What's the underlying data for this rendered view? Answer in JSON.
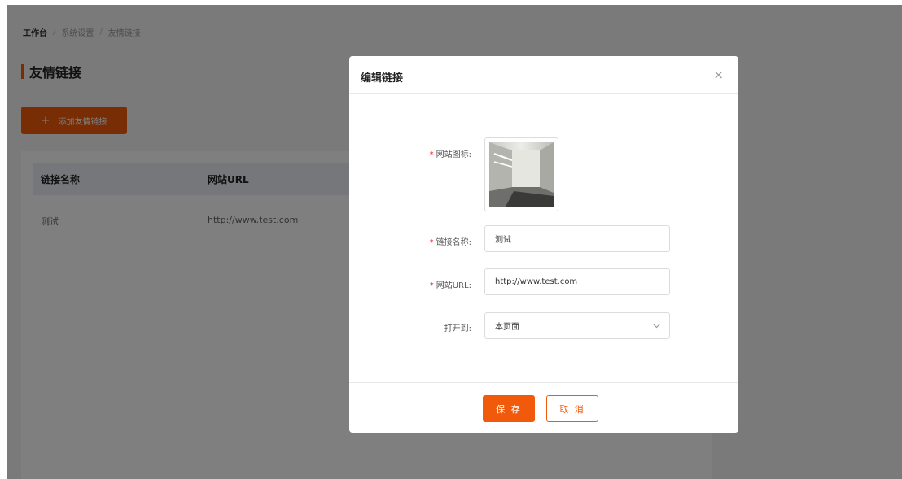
{
  "breadcrumb": [
    "工作台",
    "系统设置",
    "友情链接"
  ],
  "breadcrumb_separator": "/",
  "page_title": "友情链接",
  "add_button": {
    "icon": "+",
    "label": "添加友情链接"
  },
  "table": {
    "headers": [
      "链接名称",
      "网站URL"
    ],
    "rows": [
      {
        "name": "测试",
        "url": "http://www.test.com"
      }
    ]
  },
  "modal": {
    "title": "编辑链接",
    "close_icon": "×",
    "form": {
      "icon_label": "网站图标:",
      "name_label": "链接名称:",
      "name_value": "测试",
      "url_label": "网站URL:",
      "url_value": "http://www.test.com",
      "open_label": "打开到:",
      "open_value": "本页面",
      "required_mark": "*"
    },
    "save_label": "保 存",
    "cancel_label": "取 消"
  },
  "colors": {
    "accent": "#f15a0a",
    "required": "#f5222d"
  }
}
